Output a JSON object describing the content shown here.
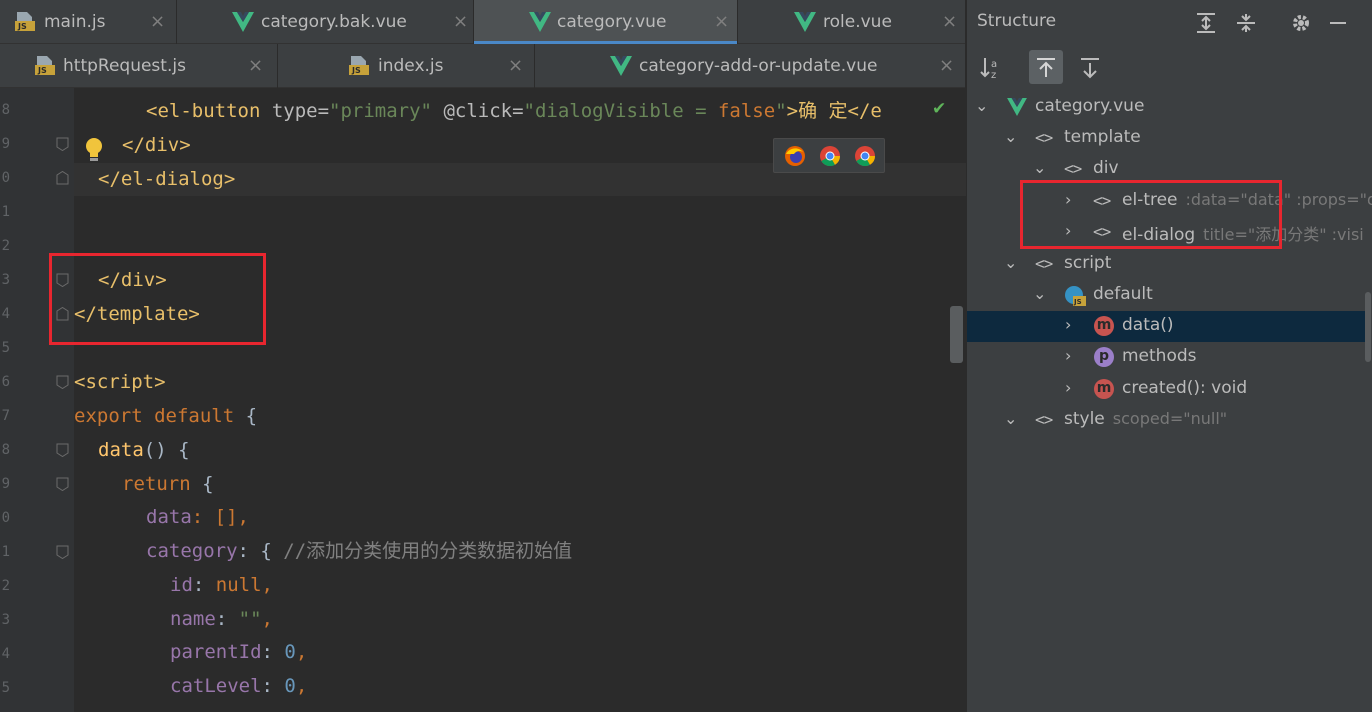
{
  "tabs_row1": [
    {
      "label": "main.js",
      "type": "js",
      "active": false
    },
    {
      "label": "category.bak.vue",
      "type": "vue",
      "active": false
    },
    {
      "label": "category.vue",
      "type": "vue",
      "active": true
    },
    {
      "label": "role.vue",
      "type": "vue",
      "active": false
    }
  ],
  "tabs_row2": [
    {
      "label": "httpRequest.js",
      "type": "js"
    },
    {
      "label": "index.js",
      "type": "js"
    },
    {
      "label": "category-add-or-update.vue",
      "type": "vue"
    }
  ],
  "close_glyph": "×",
  "gutter": {
    "line_numbers": [
      "8",
      "9",
      "0",
      "1",
      "2",
      "3",
      "4",
      "5",
      "6",
      "7",
      "8",
      "9",
      "0",
      "1",
      "2",
      "3",
      "4",
      "5"
    ]
  },
  "code": {
    "l1": {
      "indent": "    ",
      "t1": "<el-button ",
      "t2": "type=",
      "t3": "\"primary\"",
      "t4": " @click=",
      "t5": "\"dialogVisible = ",
      "t6": "false",
      "t7": "\"",
      "t8": ">确 定</e"
    },
    "l2": {
      "indent": "  ",
      "t1": "</div>"
    },
    "l3": {
      "indent": " ",
      "t1": "</el-dialog>"
    },
    "l4": {
      "indent": " ",
      "t1": "</div>"
    },
    "l5": {
      "indent": "",
      "t1": "</template>"
    },
    "l6": {
      "indent": "",
      "t1": "<script>"
    },
    "l7": {
      "indent": "",
      "t1": "export default",
      "t2": " {"
    },
    "l8": {
      "indent": " ",
      "t1": "data",
      "t2": "() {"
    },
    "l9": {
      "indent": "  ",
      "t1": "return",
      "t2": " {"
    },
    "l10": {
      "indent": "   ",
      "t1": "data",
      "t2": ": [],"
    },
    "l11": {
      "indent": "   ",
      "t1": "category",
      "t2": ": { ",
      "t3": "//添加分类使用的分类数据初始值"
    },
    "l12": {
      "indent": "    ",
      "t1": "id",
      "t2": ": ",
      "t3": "null",
      "t4": ","
    },
    "l13": {
      "indent": "    ",
      "t1": "name",
      "t2": ": ",
      "t3": "\"\"",
      "t4": ","
    },
    "l14": {
      "indent": "    ",
      "t1": "parentId",
      "t2": ": ",
      "t3": "0",
      "t4": ","
    },
    "l15": {
      "indent": "    ",
      "t1": "catLevel",
      "t2": ": ",
      "t3": "0",
      "t4": ","
    }
  },
  "structure": {
    "title": "Structure",
    "nodes": [
      {
        "label": "category.vue",
        "extra": ""
      },
      {
        "label": "template",
        "extra": ""
      },
      {
        "label": "div",
        "extra": ""
      },
      {
        "label": "el-tree",
        "extra": ":data=\"data\" :props=\"d"
      },
      {
        "label": "el-dialog",
        "extra": "title=\"添加分类\" :visi"
      },
      {
        "label": "script",
        "extra": ""
      },
      {
        "label": "default",
        "extra": ""
      },
      {
        "label": "data()",
        "extra": ""
      },
      {
        "label": "methods",
        "extra": ""
      },
      {
        "label": "created(): void",
        "extra": ""
      },
      {
        "label": "style",
        "extra": "scoped=\"null\""
      }
    ]
  },
  "glyphs": {
    "chev_down": "⌄",
    "chev_right": "›",
    "tag": "<>",
    "m": "m",
    "p": "p"
  },
  "colors": {
    "accent": "#4a88c7",
    "highlight_box": "#e8262f",
    "selection": "#0d293e"
  }
}
